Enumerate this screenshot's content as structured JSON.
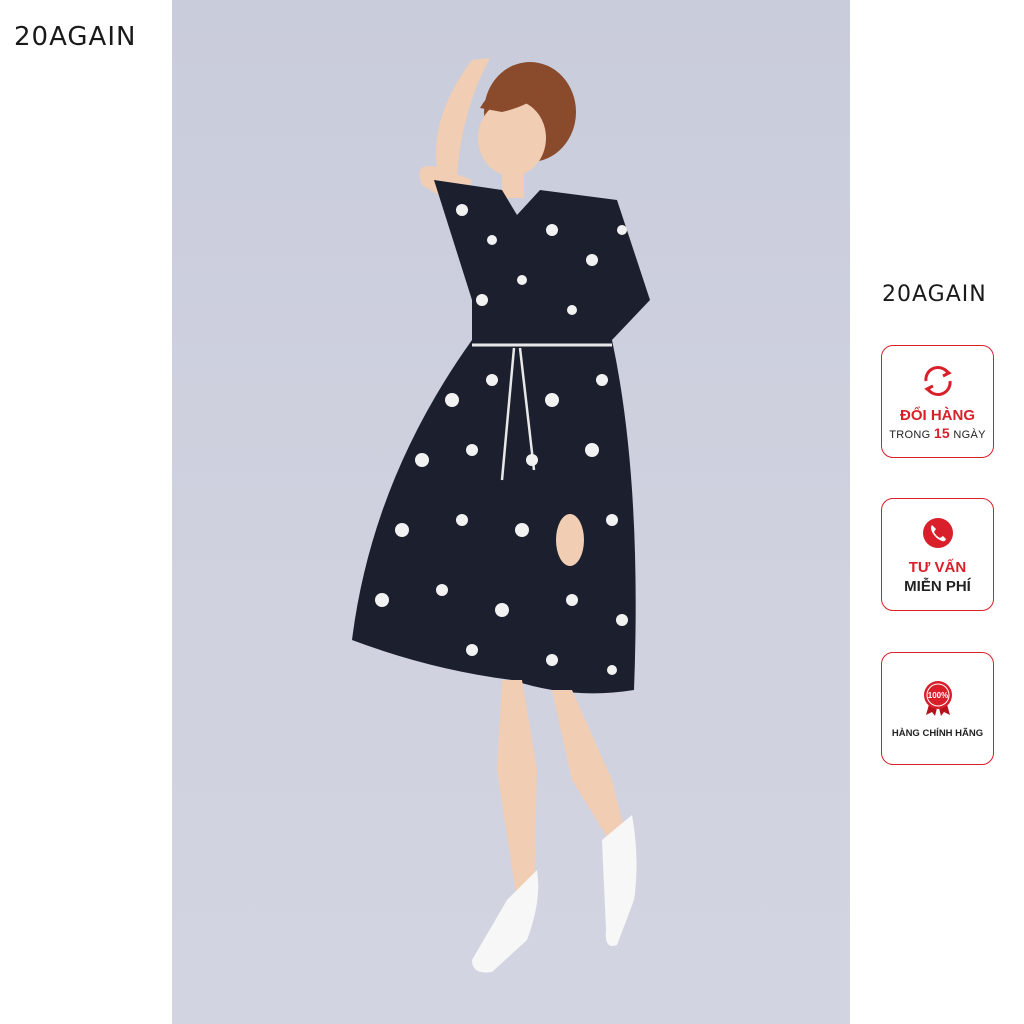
{
  "brand": {
    "logo_text": "20AGAIN"
  },
  "photo": {
    "subject": "model-in-floral-wrap-dress"
  },
  "badges": {
    "exchange": {
      "title": "ĐỔI HÀNG",
      "prefix": "TRONG",
      "days": "15",
      "suffix": "NGÀY",
      "icon": "refresh-icon"
    },
    "consult": {
      "line1": "TƯ VẤN",
      "line2": "MIỄN PHÍ",
      "icon": "phone-icon"
    },
    "authentic": {
      "seal": "100%",
      "label": "HÀNG CHÍNH HÃNG",
      "icon": "ribbon-seal-icon"
    }
  },
  "colors": {
    "accent": "#d81f2a",
    "photo_bg": "#cdd0de",
    "dress": "#1c1f2e"
  }
}
